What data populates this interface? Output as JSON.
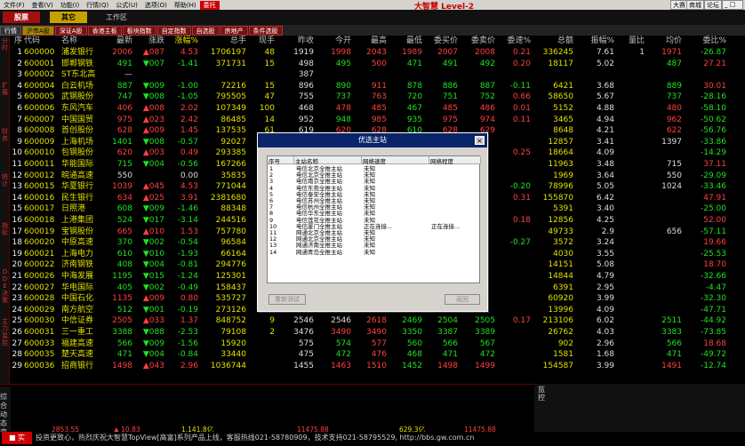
{
  "menu": {
    "items": [
      "文件(F)",
      "查看(V)",
      "功能(I)",
      "行情(Q)",
      "公式(U)",
      "选项(O)",
      "帮助(H)"
    ],
    "special": "委托",
    "brand": "大智慧 Level-2",
    "right_buttons": [
      "大赛",
      "商城",
      "论坛"
    ]
  },
  "toolbar": {
    "btn_a": "股票",
    "btn_b": "其它",
    "label": "工作区"
  },
  "sections": {
    "lead": "行情",
    "items": [
      "沪市A股",
      "深证A股",
      "香港主板",
      "板块指数",
      "自定指数",
      "自选股",
      "房地产",
      "条件选股"
    ],
    "current_index": 0
  },
  "sidebar": {
    "labels": [
      "分时",
      "扩展",
      "财务",
      "统计",
      "指标",
      "DDE决策",
      "主力监控"
    ]
  },
  "columns": [
    "序",
    "代码",
    "名称",
    "最新",
    "涨跌",
    "涨幅%",
    "总手",
    "现手",
    "昨收",
    "今开",
    "最高",
    "最低",
    "委买价",
    "委卖价",
    "委速%",
    "总额",
    "振幅%",
    "量比",
    "均价",
    "委比%"
  ],
  "rows": [
    [
      "1",
      "600000",
      "浦发银行",
      "2006",
      "▲087",
      "4.53",
      "1706197",
      "48",
      "1919",
      "1998",
      "2043",
      "1989",
      "2007",
      "2008",
      "0.21",
      "336245",
      "7.61",
      "1",
      "1971",
      "-26.87"
    ],
    [
      "2",
      "600001",
      "邯郸钢铁",
      "491",
      "▼007",
      "-1.41",
      "371731",
      "15",
      "498",
      "495",
      "500",
      "471",
      "491",
      "492",
      "0.20",
      "18117",
      "5.02",
      "",
      "487",
      "27.21"
    ],
    [
      "3",
      "600002",
      "ST东北高",
      "—",
      "",
      "",
      "",
      "",
      "387",
      "",
      "",
      "",
      "",
      "",
      "",
      "",
      "",
      "",
      "",
      ""
    ],
    [
      "4",
      "600004",
      "白云机场",
      "887",
      "▼009",
      "-1.00",
      "72216",
      "15",
      "896",
      "890",
      "911",
      "878",
      "886",
      "887",
      "-0.11",
      "6421",
      "3.68",
      "",
      "889",
      "30.01"
    ],
    [
      "5",
      "600005",
      "武钢股份",
      "747",
      "▼008",
      "-1.05",
      "795505",
      "47",
      "755",
      "737",
      "763",
      "720",
      "751",
      "752",
      "0.66",
      "58650",
      "5.67",
      "",
      "737",
      "-28.16"
    ],
    [
      "6",
      "600006",
      "东风汽车",
      "406",
      "▲008",
      "2.02",
      "107349",
      "100",
      "468",
      "478",
      "485",
      "467",
      "485",
      "486",
      "0.01",
      "5152",
      "4.88",
      "",
      "480",
      "-58.10"
    ],
    [
      "7",
      "600007",
      "中国国贸",
      "975",
      "▲023",
      "2.42",
      "86485",
      "14",
      "952",
      "948",
      "985",
      "935",
      "975",
      "974",
      "0.11",
      "3465",
      "4.94",
      "",
      "962",
      "-50.62"
    ],
    [
      "8",
      "600008",
      "首创股份",
      "628",
      "▲009",
      "1.45",
      "137535",
      "61",
      "619",
      "620",
      "628",
      "610",
      "628",
      "629",
      "",
      "8648",
      "4.21",
      "",
      "622",
      "-56.76"
    ],
    [
      "9",
      "600009",
      "上海机场",
      "1401",
      "▼008",
      "-0.57",
      "92027",
      "",
      "",
      "",
      "",
      "",
      "",
      "",
      "",
      "12857",
      "3.41",
      "",
      "1397",
      "-33.86"
    ],
    [
      "10",
      "600010",
      "包钢股份",
      "620",
      "▲003",
      "0.49",
      "293385",
      "",
      "",
      "",
      "",
      "",
      "",
      "",
      "0.25",
      "18664",
      "4.09",
      "",
      "",
      "-14.29"
    ],
    [
      "11",
      "600011",
      "华能国际",
      "715",
      "▼004",
      "-0.56",
      "167266",
      "",
      "",
      "",
      "",
      "",
      "",
      "",
      "",
      "11963",
      "3.48",
      "",
      "715",
      "37.11"
    ],
    [
      "12",
      "600012",
      "皖通高速",
      "550",
      "",
      "0.00",
      "35835",
      "",
      "",
      "",
      "",
      "",
      "",
      "",
      "",
      "1969",
      "3.64",
      "",
      "550",
      "-29.09"
    ],
    [
      "13",
      "600015",
      "华夏银行",
      "1039",
      "▲045",
      "4.53",
      "771044",
      "",
      "",
      "",
      "",
      "",
      "",
      "",
      "-0.20",
      "78996",
      "5.05",
      "",
      "1024",
      "-33.46"
    ],
    [
      "14",
      "600016",
      "民生银行",
      "634",
      "▲025",
      "3.91",
      "2381680",
      "",
      "",
      "",
      "",
      "",
      "",
      "",
      "0.31",
      "155870",
      "6.42",
      "",
      "",
      "47.91"
    ],
    [
      "15",
      "600017",
      "日照港",
      "608",
      "▼009",
      "-1.46",
      "88348",
      "",
      "",
      "",
      "",
      "",
      "",
      "",
      "",
      "5391",
      "3.40",
      "",
      "",
      "-25.00"
    ],
    [
      "16",
      "600018",
      "上港集团",
      "524",
      "▼017",
      "-3.14",
      "244516",
      "",
      "",
      "",
      "",
      "",
      "",
      "",
      "0.18",
      "12856",
      "4.25",
      "",
      "",
      "52.00"
    ],
    [
      "17",
      "600019",
      "宝钢股份",
      "665",
      "▲010",
      "1.53",
      "757780",
      "",
      "",
      "",
      "",
      "",
      "",
      "",
      "",
      "49733",
      "2.9",
      "",
      "656",
      "-57.11"
    ],
    [
      "18",
      "600020",
      "中原高速",
      "370",
      "▼002",
      "-0.54",
      "96584",
      "",
      "",
      "",
      "",
      "",
      "",
      "",
      "-0.27",
      "3572",
      "3.24",
      "",
      "",
      "19.66"
    ],
    [
      "19",
      "600021",
      "上海电力",
      "610",
      "▼010",
      "-1.93",
      "66164",
      "",
      "",
      "",
      "",
      "",
      "",
      "",
      "",
      "4030",
      "3.55",
      "",
      "",
      "-25.53"
    ],
    [
      "20",
      "600022",
      "济南钢铁",
      "408",
      "▼004",
      "-0.81",
      "294776",
      "",
      "",
      "",
      "",
      "",
      "",
      "",
      "",
      "14151",
      "5.08",
      "",
      "",
      "18.70"
    ],
    [
      "21",
      "600026",
      "中海发展",
      "1195",
      "▼015",
      "-1.24",
      "125301",
      "",
      "",
      "",
      "",
      "",
      "",
      "",
      "",
      "14844",
      "4.79",
      "",
      "",
      "-32.66"
    ],
    [
      "22",
      "600027",
      "华电国际",
      "405",
      "▼002",
      "-0.49",
      "158437",
      "",
      "",
      "",
      "",
      "",
      "",
      "",
      "",
      "6391",
      "2.95",
      "",
      "",
      "-4.47"
    ],
    [
      "23",
      "600028",
      "中国石化",
      "1135",
      "▲009",
      "0.80",
      "535727",
      "",
      "",
      "",
      "",
      "",
      "",
      "",
      "",
      "60920",
      "3.99",
      "",
      "",
      "-32.30"
    ],
    [
      "24",
      "600029",
      "南方航空",
      "512",
      "▼001",
      "-0.19",
      "273126",
      "",
      "",
      "",
      "",
      "",
      "",
      "",
      "",
      "13996",
      "4.09",
      "",
      "",
      "-47.71"
    ],
    [
      "25",
      "600030",
      "中信证券",
      "2505",
      "▲033",
      "1.37",
      "848752",
      "9",
      "2546",
      "2546",
      "2618",
      "2469",
      "2504",
      "2505",
      "0.17",
      "213106",
      "6.02",
      "",
      "2511",
      "-44.92"
    ],
    [
      "26",
      "600031",
      "三一重工",
      "3388",
      "▼088",
      "-2.53",
      "79108",
      "2",
      "3476",
      "3490",
      "3490",
      "3350",
      "3387",
      "3389",
      "",
      "26762",
      "4.03",
      "",
      "3383",
      "-73.85"
    ],
    [
      "27",
      "600033",
      "福建高速",
      "566",
      "▼009",
      "-1.56",
      "15920",
      "",
      "575",
      "574",
      "577",
      "560",
      "566",
      "567",
      "",
      "902",
      "2.96",
      "",
      "566",
      "18.68"
    ],
    [
      "28",
      "600035",
      "楚天高速",
      "471",
      "▼004",
      "-0.84",
      "33440",
      "",
      "475",
      "472",
      "476",
      "468",
      "471",
      "472",
      "",
      "1581",
      "1.68",
      "",
      "471",
      "-49.72"
    ],
    [
      "29",
      "600036",
      "招商银行",
      "1498",
      "▲043",
      "2.96",
      "1036744",
      "",
      "1455",
      "1463",
      "1510",
      "1452",
      "1498",
      "1499",
      "",
      "154587",
      "3.99",
      "",
      "1491",
      "-12.74"
    ]
  ],
  "dialog": {
    "title": "优选主站",
    "close": "×",
    "headers": [
      "序号",
      "主站名称",
      "网络速度",
      "网络程度"
    ],
    "rows": [
      [
        "1",
        "电信北京全推主站",
        "未知",
        ""
      ],
      [
        "2",
        "电信北京全推主站",
        "未知",
        ""
      ],
      [
        "3",
        "电信南京全推主站",
        "未知",
        ""
      ],
      [
        "4",
        "电信东莞全推主站",
        "未知",
        ""
      ],
      [
        "5",
        "电信泰安全推主站",
        "未知",
        ""
      ],
      [
        "6",
        "电信苏州全推主站",
        "未知",
        ""
      ],
      [
        "7",
        "电信杭州全推主站",
        "未知",
        ""
      ],
      [
        "8",
        "电信华东全推主站",
        "未知",
        ""
      ],
      [
        "9",
        "电信莲花全推主站",
        "未知",
        ""
      ],
      [
        "10",
        "电信厦门全推主站",
        "正在连接...",
        "正在连接..."
      ],
      [
        "11",
        "网通北京全推主站",
        "未知",
        ""
      ],
      [
        "12",
        "网通北京全推主站",
        "未知",
        ""
      ],
      [
        "13",
        "网通济南全推主站",
        "未知",
        ""
      ],
      [
        "14",
        "网通青岛全推主站",
        "未知",
        ""
      ]
    ],
    "btn_retest": "重新测试",
    "btn_return": "返回"
  },
  "bottom": {
    "index1": "2853.55",
    "change1": "▲ 10.83",
    "amount1": "1,141.8亿",
    "index2": "11475.88",
    "index3": "11475.88",
    "amount2": "629.3亿",
    "right_labels": [
      "综合",
      "动态",
      "资讯"
    ],
    "corner_label": "监控"
  },
  "status": {
    "text": "投资更致心，热烈庆祝大智慧TopView[高富]系列产品上线，客服热线021-58780909，技术支持021-58795529, http://bbs.gw.com.cn"
  },
  "colors": {
    "up": "#ff4040",
    "down": "#20e020",
    "title_bar": "#0a246a",
    "accent": "#c00000"
  }
}
